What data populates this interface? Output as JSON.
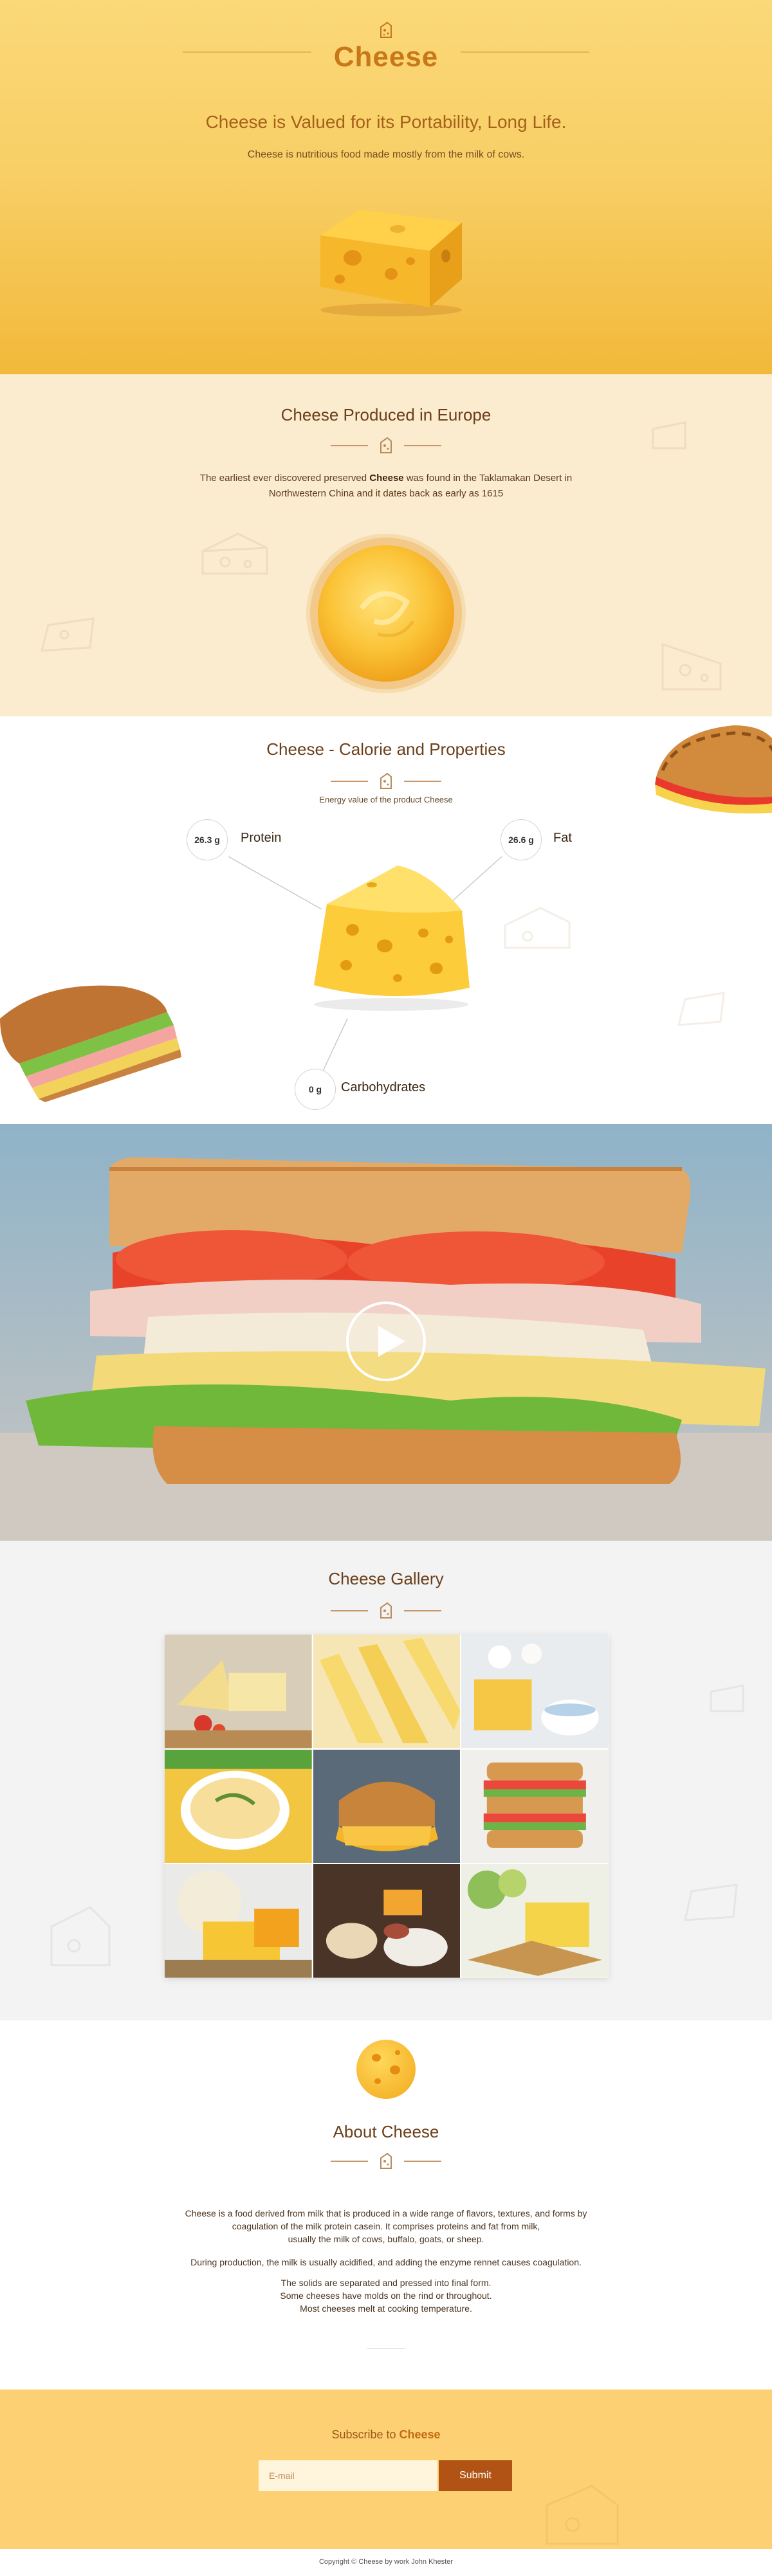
{
  "hero": {
    "brand": "Cheese",
    "headline": "Cheese is Valued for its Portability, Long Life.",
    "subtitle": "Cheese is nutritious food made mostly from the milk of cows."
  },
  "europe": {
    "title": "Cheese Produced in Europe",
    "text_before": "The earliest ever discovered preserved ",
    "text_bold": "Cheese",
    "text_after": " was found in the Taklamakan Desert in Northwestern China and it dates back as early as 1615"
  },
  "calorie": {
    "title": "Cheese - Calorie and Properties",
    "energy": "Energy value of the product Cheese",
    "nutrients": {
      "protein": {
        "value": "26.3 g",
        "label": "Protein"
      },
      "fat": {
        "value": "26.6 g",
        "label": "Fat"
      },
      "carbs": {
        "value": "0 g",
        "label": "Carbohydrates"
      }
    }
  },
  "gallery": {
    "title": "Cheese Gallery"
  },
  "about": {
    "title": "About Cheese",
    "p1_line1": "Cheese is a food derived from milk that is produced in a wide range of flavors, textures, and forms by",
    "p1_line2": "coagulation of the milk protein casein. It comprises proteins and fat from milk,",
    "p1_line3": "usually the milk of cows, buffalo, goats, or sheep.",
    "p2": "During production, the milk is usually acidified, and adding the enzyme rennet causes coagulation.",
    "p3_line1": "The solids are separated and pressed into final form.",
    "p3_line2": "Some cheeses have molds on the rind or throughout.",
    "p3_line3": "Most cheeses melt at cooking temperature."
  },
  "subscribe": {
    "label_prefix": "Subscribe to ",
    "label_brand": "Cheese",
    "email_placeholder": "E-mail",
    "button": "Submit"
  },
  "footer": {
    "copyright": "Copyright © Cheese by work John Khester"
  },
  "colors": {
    "accent": "#c87818",
    "button": "#b15315",
    "cream": "#fbebcf",
    "yellow": "#fdd173"
  }
}
